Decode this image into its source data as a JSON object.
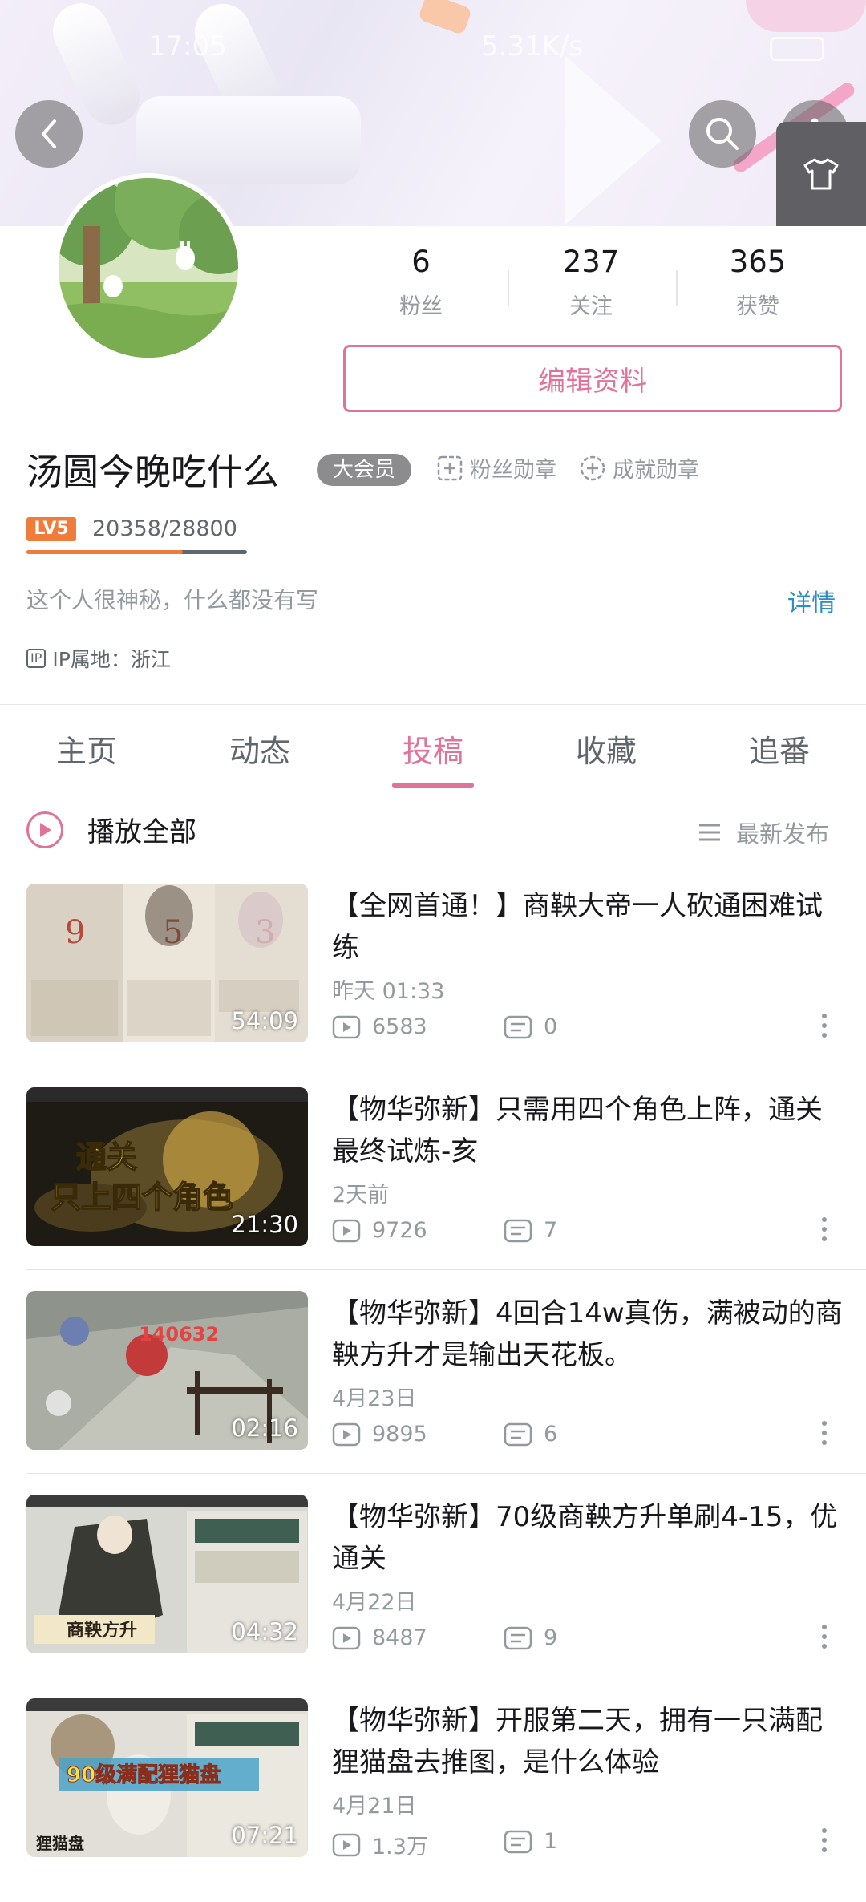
{
  "status_bar": {
    "time": "17:05",
    "network": "5.31K/s"
  },
  "profile": {
    "stats": [
      {
        "value": "6",
        "label": "粉丝"
      },
      {
        "value": "237",
        "label": "关注"
      },
      {
        "value": "365",
        "label": "获赞"
      }
    ],
    "edit_label": "编辑资料",
    "username": "汤圆今晚吃什么",
    "vip_label": "大会员",
    "fan_medal_label": "粉丝勋章",
    "achievement_medal_label": "成就勋章",
    "level_badge": "LV5",
    "level_progress": "20358/28800",
    "level_fraction": 0.71,
    "bio": "这个人很神秘，什么都没有写",
    "detail_link": "详情",
    "ip_tag": "IP",
    "ip_location": "IP属地：浙江"
  },
  "tabs": [
    {
      "label": "主页"
    },
    {
      "label": "动态"
    },
    {
      "label": "投稿"
    },
    {
      "label": "收藏"
    },
    {
      "label": "追番"
    }
  ],
  "active_tab": "投稿",
  "list_header": {
    "play_all": "播放全部",
    "sort": "最新发布"
  },
  "videos": [
    {
      "title": "【全网首通！】商鞅大帝一人砍通困难试练",
      "date": "昨天 01:33",
      "plays": "6583",
      "comments": "0",
      "duration": "54:09"
    },
    {
      "title": "【物华弥新】只需用四个角色上阵，通关最终试炼-亥",
      "date": "2天前",
      "plays": "9726",
      "comments": "7",
      "duration": "21:30"
    },
    {
      "title": "【物华弥新】4回合14w真伤，满被动的商鞅方升才是输出天花板。",
      "date": "4月23日",
      "plays": "9895",
      "comments": "6",
      "duration": "02:16"
    },
    {
      "title": "【物华弥新】70级商鞅方升单刷4-15，优通关",
      "date": "4月22日",
      "plays": "8487",
      "comments": "9",
      "duration": "04:32"
    },
    {
      "title": "【物华弥新】开服第二天，拥有一只满配狸猫盘去推图，是什么体验",
      "date": "4月21日",
      "plays": "1.3万",
      "comments": "1",
      "duration": "07:21"
    }
  ],
  "thumb_texts": {
    "v1_nums": [
      "9",
      "5",
      "3"
    ],
    "v2_caption_1": "通关",
    "v2_caption_2": "只上四个角色",
    "v3_damage": "140632",
    "v4_name": "商鞅方升",
    "v5_caption": "90级满配狸猫盘",
    "v5_name": "狸猫盘"
  },
  "colors": {
    "accent": "#e07498",
    "link": "#2a8ec6",
    "level": "#f07c3c"
  }
}
